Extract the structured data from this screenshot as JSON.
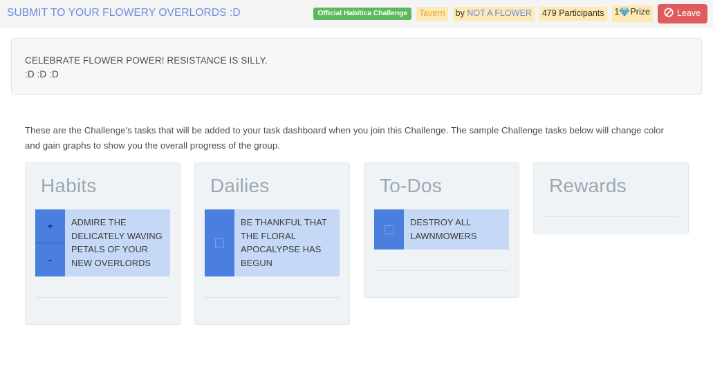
{
  "header": {
    "title": "SUBMIT TO YOUR FLOWERY OVERLORDS :D",
    "official_badge": "Official Habitica Challenge",
    "location": "Tavern",
    "author_prefix": "by",
    "author": "NOT A FLOWER",
    "participants": "479 Participants",
    "prize_count": "1",
    "prize_label": "Prize",
    "prize_gem_icon": "gem-icon",
    "leave_label": "Leave",
    "leave_icon": "ban-icon",
    "title_color": "#6b8cdd",
    "official_badge_color": "#5cb85c",
    "highlight_color": "#fce9b4",
    "leave_button_color": "#e05c5c"
  },
  "description": {
    "line1": "CELEBRATE FLOWER POWER! RESISTANCE IS SILLY.",
    "line2": ":D :D :D"
  },
  "intro": {
    "text": "These are the Challenge's tasks that will be added to your task dashboard when you join this Challenge. The sample Challenge tasks below will change color and gain graphs to show you the overall progress of the group."
  },
  "columns": [
    {
      "title": "Habits",
      "type": "habit",
      "control_plus": "+",
      "control_minus": "-",
      "tasks": [
        {
          "text": "ADMIRE THE DELICATELY WAVING PETALS OF YOUR NEW OVERLORDS"
        }
      ],
      "has_divider": true,
      "bottom_pad": 38
    },
    {
      "title": "Dailies",
      "type": "daily",
      "checkbox_icon": "checkbox-icon",
      "tasks": [
        {
          "text": "BE THANKFUL THAT THE FLORAL APOCALYPSE HAS BEGUN"
        }
      ],
      "has_divider": true,
      "bottom_pad": 38
    },
    {
      "title": "To-Dos",
      "type": "todo",
      "checkbox_icon": "checkbox-icon",
      "tasks": [
        {
          "text": "DESTROY ALL LAWNMOWERS"
        }
      ],
      "has_divider": true,
      "bottom_pad": 38
    },
    {
      "title": "Rewards",
      "type": "reward",
      "tasks": [],
      "has_divider": true,
      "bottom_pad": 24
    }
  ],
  "colors": {
    "task_body": "#c5d8f5",
    "task_control": "#4a7fe0",
    "column_bg": "#eff3f5",
    "column_title": "#9aa8b4"
  }
}
